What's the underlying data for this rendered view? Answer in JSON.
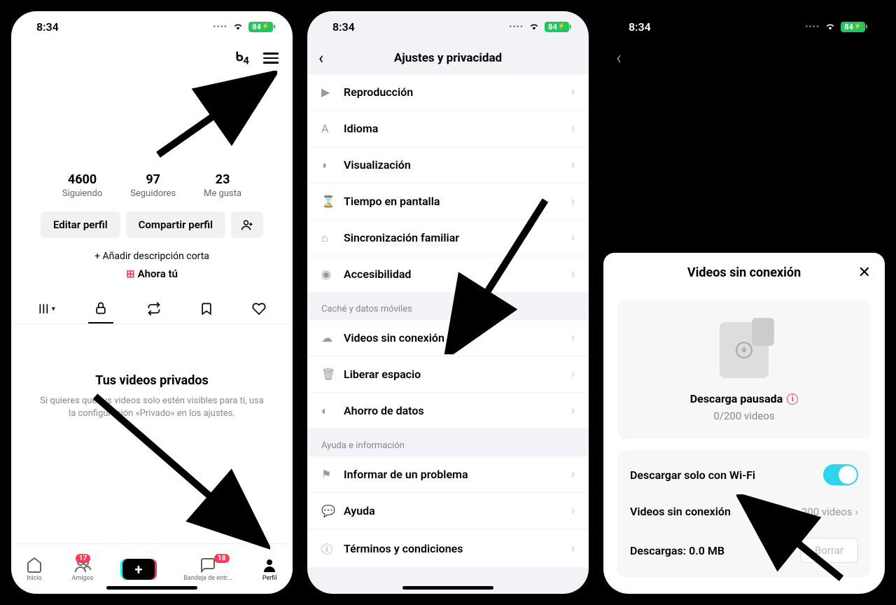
{
  "status": {
    "time": "8:34",
    "battery": "84"
  },
  "profile": {
    "streak": "4",
    "stats": {
      "following": {
        "num": "4600",
        "label": "Siguiendo"
      },
      "followers": {
        "num": "97",
        "label": "Seguidores"
      },
      "likes": {
        "num": "23",
        "label": "Me gusta"
      }
    },
    "buttons": {
      "edit": "Editar perfil",
      "share": "Compartir perfil"
    },
    "add_bio": "+ Añadir descripción corta",
    "now_you": "Ahora tú",
    "private": {
      "title": "Tus videos privados",
      "desc": "Si quieres que tus videos solo estén visibles para ti, usa la configuración «Privado» en los ajustes."
    },
    "nav": {
      "home": "Inicio",
      "friends": "Amigos",
      "friends_badge": "17",
      "inbox": "Bandeja de entr...",
      "inbox_badge": "18",
      "profile": "Perfil"
    }
  },
  "settings": {
    "title": "Ajustes y privacidad",
    "items": {
      "playback": "Reproducción",
      "language": "Idioma",
      "display": "Visualización",
      "screentime": "Tiempo en pantalla",
      "family": "Sincronización familiar",
      "accessibility": "Accesibilidad",
      "offline": "Videos sin conexión",
      "freespace": "Liberar espacio",
      "datasaver": "Ahorro de datos",
      "report": "Informar de un problema",
      "help": "Ayuda",
      "terms": "Términos y condiciones"
    },
    "sections": {
      "cache": "Caché y datos móviles",
      "help": "Ayuda e información"
    }
  },
  "offline": {
    "title": "Videos sin conexión",
    "paused": "Descarga pausada",
    "count": "0/200 videos",
    "wifi_only": "Descargar solo con Wi-Fi",
    "videos_label": "Videos sin conexión",
    "videos_value": "200 videos",
    "downloads_label": "Descargas: 0.0 MB",
    "delete": "Borrar"
  }
}
